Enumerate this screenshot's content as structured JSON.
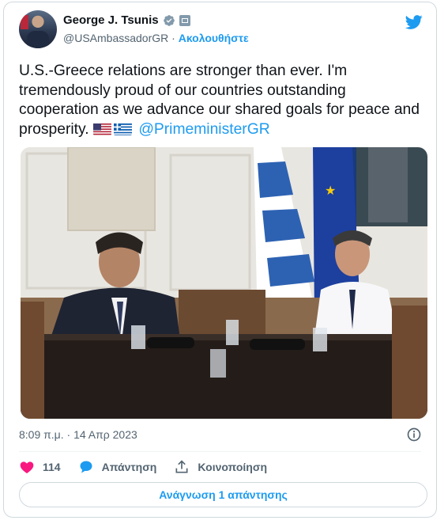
{
  "user": {
    "name": "George J. Tsunis",
    "handle": "@USAmbassadorGR",
    "separator": "·",
    "follow_label": "Ακολουθήστε"
  },
  "tweet": {
    "text": "U.S.-Greece relations are stronger than ever. I'm tremendously proud of our countries outstanding cooperation as we advance our shared goals for peace and prosperity.",
    "flags": [
      "us-flag",
      "greek-flag"
    ],
    "mention": "@PrimeministerGR"
  },
  "timestamp": "8:09 π.μ. · 14 Απρ 2023",
  "actions": {
    "like_count": "114",
    "reply_label": "Απάντηση",
    "share_label": "Κοινοποίηση"
  },
  "read_replies_label": "Ανάγνωση 1 απάντησης",
  "icons": {
    "verified": "verified-badge-icon",
    "gov": "government-badge-icon",
    "brand": "twitter-bird-icon",
    "info": "info-icon",
    "like": "heart-icon",
    "reply": "speech-bubble-icon",
    "share": "share-icon"
  },
  "colors": {
    "accent": "#1d9bf0",
    "like": "#f91880",
    "text": "#0f1419",
    "muted": "#536471"
  }
}
